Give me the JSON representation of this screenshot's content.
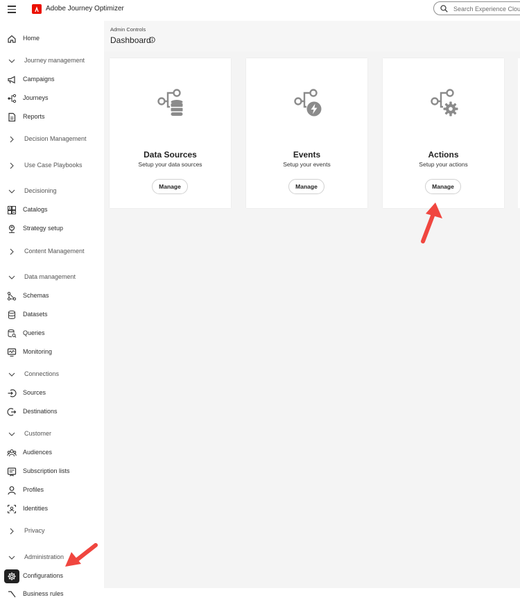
{
  "topbar": {
    "app_title": "Adobe Journey Optimizer",
    "search_placeholder": "Search Experience Cloud",
    "brand_color": "#eb1000"
  },
  "sidebar": {
    "items": [
      {
        "type": "item",
        "label": "Home",
        "icon": "home-icon"
      },
      {
        "type": "section",
        "label": "Journey management",
        "expanded": true
      },
      {
        "type": "item",
        "label": "Campaigns",
        "icon": "megaphone-icon"
      },
      {
        "type": "item",
        "label": "Journeys",
        "icon": "journey-icon"
      },
      {
        "type": "item",
        "label": "Reports",
        "icon": "report-icon"
      },
      {
        "type": "section",
        "label": "Decision Management",
        "expanded": false
      },
      {
        "type": "section",
        "label": "Use Case Playbooks",
        "expanded": false
      },
      {
        "type": "section",
        "label": "Decisioning",
        "expanded": true
      },
      {
        "type": "item",
        "label": "Catalogs",
        "icon": "catalog-icon"
      },
      {
        "type": "item",
        "label": "Strategy setup",
        "icon": "strategy-icon"
      },
      {
        "type": "section",
        "label": "Content Management",
        "expanded": false
      },
      {
        "type": "section",
        "label": "Data management",
        "expanded": true
      },
      {
        "type": "item",
        "label": "Schemas",
        "icon": "schema-icon"
      },
      {
        "type": "item",
        "label": "Datasets",
        "icon": "dataset-icon"
      },
      {
        "type": "item",
        "label": "Queries",
        "icon": "query-icon"
      },
      {
        "type": "item",
        "label": "Monitoring",
        "icon": "monitoring-icon"
      },
      {
        "type": "section",
        "label": "Connections",
        "expanded": true
      },
      {
        "type": "item",
        "label": "Sources",
        "icon": "sources-icon"
      },
      {
        "type": "item",
        "label": "Destinations",
        "icon": "destinations-icon"
      },
      {
        "type": "section",
        "label": "Customer",
        "expanded": true
      },
      {
        "type": "item",
        "label": "Audiences",
        "icon": "audiences-icon"
      },
      {
        "type": "item",
        "label": "Subscription lists",
        "icon": "subscription-icon"
      },
      {
        "type": "item",
        "label": "Profiles",
        "icon": "profile-icon"
      },
      {
        "type": "item",
        "label": "Identities",
        "icon": "identity-icon"
      },
      {
        "type": "section",
        "label": "Privacy",
        "expanded": false
      },
      {
        "type": "section",
        "label": "Administration",
        "expanded": true
      },
      {
        "type": "item",
        "label": "Configurations",
        "icon": "gear-icon",
        "active": true
      },
      {
        "type": "item",
        "label": "Business rules",
        "icon": "rules-icon"
      }
    ]
  },
  "main": {
    "breadcrumb": "Admin Controls",
    "title": "Dashboard",
    "cards": [
      {
        "title": "Data Sources",
        "subtitle": "Setup your data sources",
        "button": "Manage",
        "icon": "data-sources-icon"
      },
      {
        "title": "Events",
        "subtitle": "Setup your events",
        "button": "Manage",
        "icon": "events-icon"
      },
      {
        "title": "Actions",
        "subtitle": "Setup your actions",
        "button": "Manage",
        "icon": "actions-icon"
      }
    ]
  },
  "annotation_color": "#f0463f"
}
